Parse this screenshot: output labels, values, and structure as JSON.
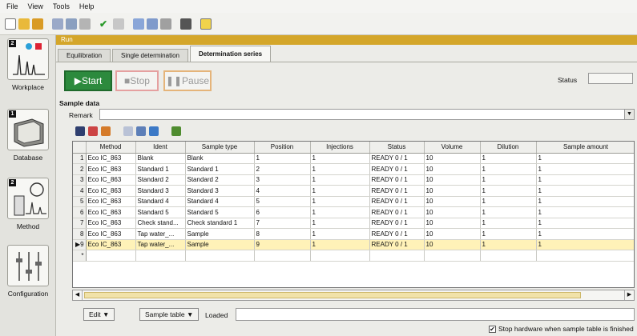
{
  "menu": [
    "File",
    "View",
    "Tools",
    "Help"
  ],
  "sidebar": [
    {
      "label": "Workplace",
      "badge": "2"
    },
    {
      "label": "Database",
      "badge": "1"
    },
    {
      "label": "Method",
      "badge": "2"
    },
    {
      "label": "Configuration",
      "badge": ""
    }
  ],
  "run": {
    "header": "Run",
    "tabs": [
      "Equilibration",
      "Single determination",
      "Determination series"
    ],
    "active_tab": 2,
    "start_label": "Start",
    "stop_label": "Stop",
    "pause_label": "Pause",
    "status_label": "Status",
    "status_value": "",
    "sample_data_label": "Sample data",
    "remark_label": "Remark",
    "remark_value": ""
  },
  "table": {
    "columns": [
      "Method",
      "Ident",
      "Sample type",
      "Position",
      "Injections",
      "Status",
      "Volume",
      "Dilution",
      "Sample amount"
    ],
    "rows": [
      [
        "1",
        "Eco IC_863",
        "Blank",
        "Blank",
        "1",
        "1",
        "READY 0 / 1",
        "10",
        "1",
        "1"
      ],
      [
        "2",
        "Eco IC_863",
        "Standard 1",
        "Standard 1",
        "2",
        "1",
        "READY 0 / 1",
        "10",
        "1",
        "1"
      ],
      [
        "3",
        "Eco IC_863",
        "Standard 2",
        "Standard 2",
        "3",
        "1",
        "READY 0 / 1",
        "10",
        "1",
        "1"
      ],
      [
        "4",
        "Eco IC_863",
        "Standard 3",
        "Standard 3",
        "4",
        "1",
        "READY 0 / 1",
        "10",
        "1",
        "1"
      ],
      [
        "5",
        "Eco IC_863",
        "Standard 4",
        "Standard 4",
        "5",
        "1",
        "READY 0 / 1",
        "10",
        "1",
        "1"
      ],
      [
        "6",
        "Eco IC_863",
        "Standard 5",
        "Standard 5",
        "6",
        "1",
        "READY 0 / 1",
        "10",
        "1",
        "1"
      ],
      [
        "7",
        "Eco IC_863",
        "Check stand...",
        "Check standard 1",
        "7",
        "1",
        "READY 0 / 1",
        "10",
        "1",
        "1"
      ],
      [
        "8",
        "Eco IC_863",
        "Tap water_...",
        "Sample",
        "8",
        "1",
        "READY 0 / 1",
        "10",
        "1",
        "1"
      ],
      [
        "9",
        "Eco IC_863",
        "Tap water_...",
        "Sample",
        "9",
        "1",
        "READY 0 / 1",
        "10",
        "1",
        "1"
      ]
    ],
    "selected_row": 8,
    "new_row_marker": "*",
    "current_row_marker": "▶"
  },
  "bottom": {
    "edit_label": "Edit ▼",
    "sample_table_label": "Sample table ▼",
    "loaded_label": "Loaded",
    "loaded_value": "",
    "stop_hw_label": "Stop hardware when sample table is finished",
    "stop_hw_checked": true
  },
  "colors": {
    "start": "#2c8a3d",
    "run_header": "#d4a62a",
    "selected_row": "#fff2b8"
  }
}
